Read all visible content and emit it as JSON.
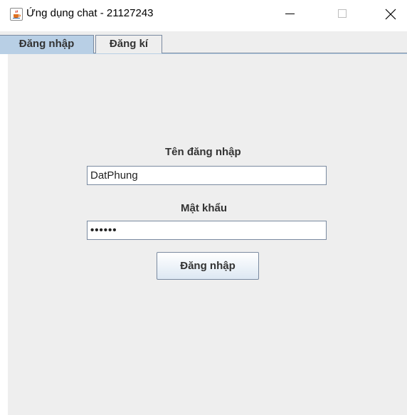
{
  "window": {
    "title": "Ứng dụng chat - 21127243",
    "icon": "java-cup-icon"
  },
  "tabs": [
    {
      "label": "Đăng nhập",
      "selected": true
    },
    {
      "label": "Đăng kí",
      "selected": false
    }
  ],
  "form": {
    "username_label": "Tên đăng nhập",
    "username_value": "DatPhung",
    "password_label": "Mật khẩu",
    "password_value": "••••••",
    "submit_label": "Đăng nhập"
  },
  "colors": {
    "selected_tab": "#b8cfe5",
    "panel_background": "#eeeeee",
    "border": "#7a8aa0"
  }
}
